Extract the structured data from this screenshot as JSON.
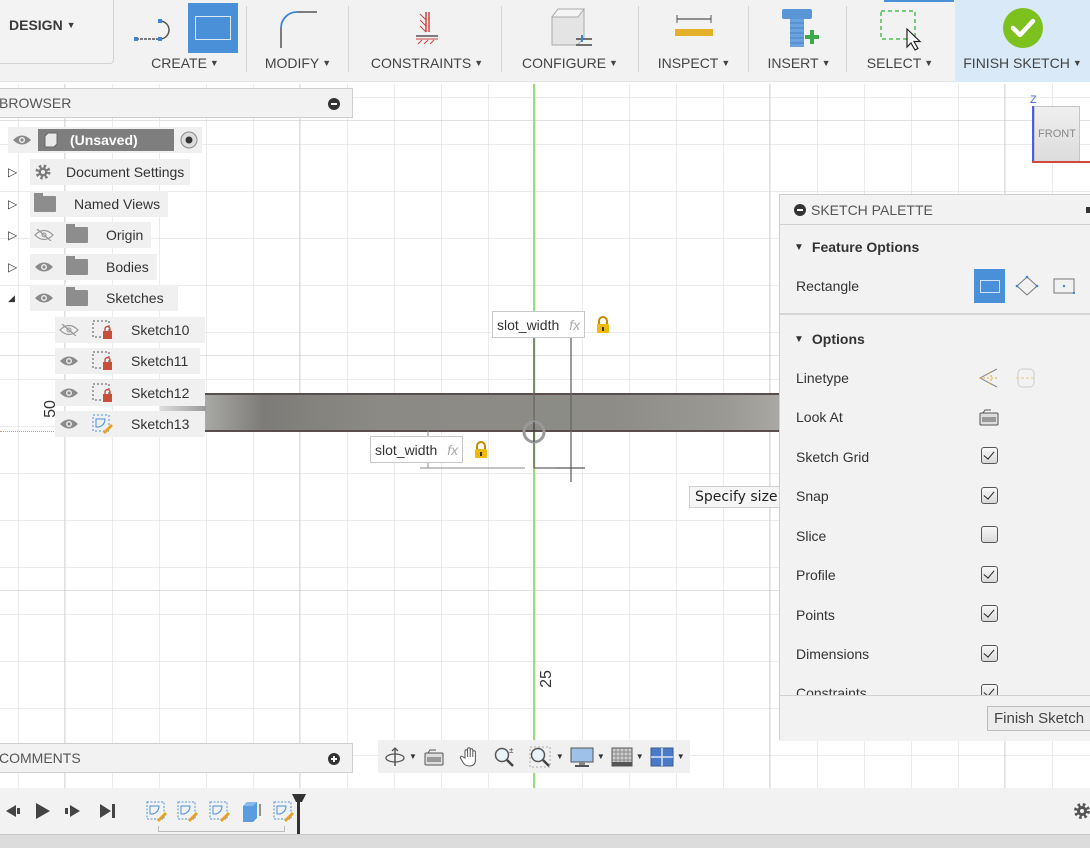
{
  "toolbar": {
    "workspace": "DESIGN",
    "groups": [
      {
        "label": "CREATE"
      },
      {
        "label": "MODIFY"
      },
      {
        "label": "CONSTRAINTS"
      },
      {
        "label": "CONFIGURE"
      },
      {
        "label": "INSPECT"
      },
      {
        "label": "INSERT"
      },
      {
        "label": "SELECT"
      },
      {
        "label": "FINISH SKETCH"
      }
    ]
  },
  "browser": {
    "title": "BROWSER",
    "root": "(Unsaved)",
    "items": [
      {
        "label": "Document Settings",
        "icon": "gear-icon"
      },
      {
        "label": "Named Views",
        "icon": "folder-icon"
      },
      {
        "label": "Origin",
        "icon": "folder-icon",
        "visible": false
      },
      {
        "label": "Bodies",
        "icon": "folder-icon",
        "visible": true
      },
      {
        "label": "Sketches",
        "icon": "folder-icon",
        "visible": true,
        "expanded": true
      }
    ],
    "sketches": [
      {
        "label": "Sketch10",
        "visible": false,
        "locked": true
      },
      {
        "label": "Sketch11",
        "visible": true,
        "locked": true
      },
      {
        "label": "Sketch12",
        "visible": true,
        "locked": true
      },
      {
        "label": "Sketch13",
        "visible": true,
        "editing": true
      }
    ]
  },
  "comments": {
    "title": "COMMENTS"
  },
  "canvas": {
    "dimension_1": {
      "value": "slot_width",
      "fx": "fx"
    },
    "dimension_2": {
      "value": "slot_width",
      "fx": "fx"
    },
    "tooltip": "Specify size of rectangle",
    "ruler_label_left": "50",
    "ruler_label_bottom": "25",
    "view_cube": {
      "face": "FRONT",
      "axis": "Z"
    }
  },
  "palette": {
    "title": "SKETCH PALETTE",
    "feature_options_title": "Feature Options",
    "rectangle_label": "Rectangle",
    "options_title": "Options",
    "options": [
      {
        "label": "Linetype",
        "type": "icons"
      },
      {
        "label": "Look At",
        "type": "icon"
      },
      {
        "label": "Sketch Grid",
        "checked": true
      },
      {
        "label": "Snap",
        "checked": true
      },
      {
        "label": "Slice",
        "checked": false
      },
      {
        "label": "Profile",
        "checked": true
      },
      {
        "label": "Points",
        "checked": true
      },
      {
        "label": "Dimensions",
        "checked": true
      },
      {
        "label": "Constraints",
        "checked": true
      }
    ],
    "finish_button": "Finish Sketch"
  },
  "colors": {
    "accent_blue": "#4a90d9",
    "finish_green": "#7dc11f",
    "axis_green": "#9cdc7c",
    "lock_yellow": "#e8b40a"
  }
}
